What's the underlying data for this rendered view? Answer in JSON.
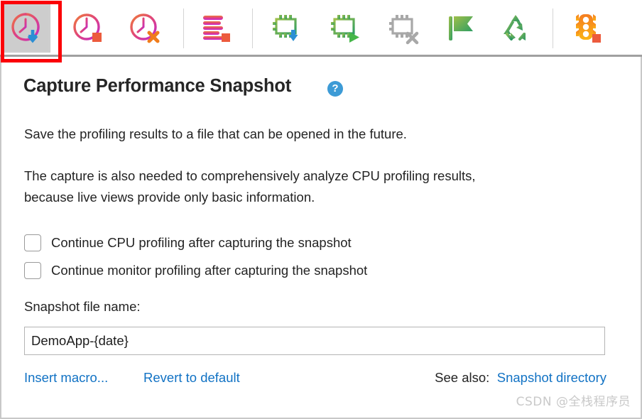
{
  "toolbar": {
    "buttons": [
      {
        "name": "capture-performance-snapshot",
        "label": "Capture Performance Snapshot",
        "icon": "clock-download-icon",
        "state": "pressed",
        "highlighted": true
      },
      {
        "name": "capture-and-stop-profiling",
        "label": "Capture Snapshot and Stop Profiling",
        "icon": "clock-stop-icon",
        "state": "normal",
        "highlighted": false
      },
      {
        "name": "cancel-profiling",
        "label": "Cancel Profiling",
        "icon": "clock-cancel-icon",
        "state": "normal",
        "highlighted": false
      },
      {
        "name": "stop-memory-profiling",
        "label": "Stop Memory Profiling",
        "icon": "stack-stop-icon",
        "state": "normal",
        "highlighted": false
      },
      {
        "name": "save-memory-snapshot",
        "label": "Save Memory Snapshot",
        "icon": "chip-download-icon",
        "state": "normal",
        "highlighted": false
      },
      {
        "name": "start-memory-profiling",
        "label": "Start Memory Profiling",
        "icon": "chip-play-icon",
        "state": "normal",
        "highlighted": false
      },
      {
        "name": "detach-memory-profiling",
        "label": "Detach Memory Profiling",
        "icon": "chip-cancel-icon",
        "state": "normal",
        "highlighted": false
      },
      {
        "name": "add-bookmark",
        "label": "Add Bookmark",
        "icon": "flag-icon",
        "state": "normal",
        "highlighted": false
      },
      {
        "name": "force-gc",
        "label": "Force Garbage Collection",
        "icon": "recycle-icon",
        "state": "normal",
        "highlighted": false
      },
      {
        "name": "stop-collecting-data",
        "label": "Stop Collecting Data",
        "icon": "traffic-light-stop-icon",
        "state": "normal",
        "highlighted": false
      }
    ],
    "highlight_color": "#fb0007",
    "separator_color": "#d4d4d4"
  },
  "panel": {
    "title": "Capture Performance Snapshot",
    "help_icon_glyph": "?",
    "help_icon_color": "#3d9bd6",
    "paragraphs": [
      "Save the profiling results to a file that can be opened in the future.",
      "The capture is also needed to comprehensively analyze CPU profiling results,\nbecause live views provide only basic information."
    ],
    "checkboxes": [
      {
        "label": "Continue CPU profiling after capturing the snapshot",
        "checked": false
      },
      {
        "label": "Continue monitor profiling after capturing the snapshot",
        "checked": false
      }
    ],
    "file_name_field": {
      "label": "Snapshot file name:",
      "value": "DemoApp-{date}",
      "placeholder": "Snapshot file name"
    },
    "links": {
      "insert_macro": "Insert macro...",
      "revert_to_default": "Revert to default",
      "see_also_label": "See also:",
      "see_also_link": "Snapshot directory",
      "link_color": "#1172c4"
    }
  },
  "watermark": "CSDN @全栈程序员"
}
